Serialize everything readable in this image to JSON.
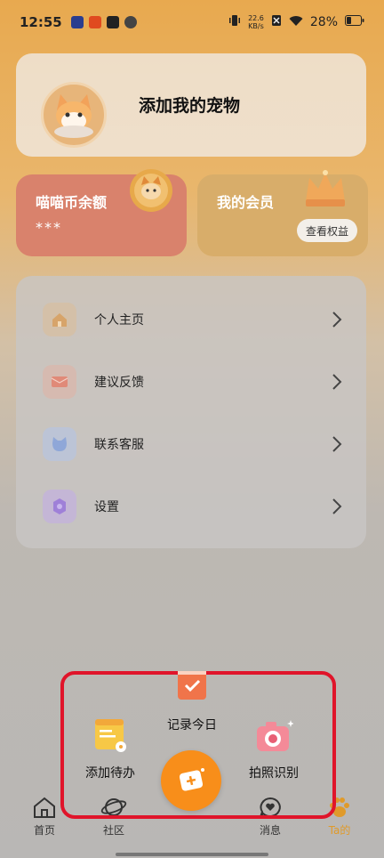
{
  "status_bar": {
    "time": "12:55",
    "net_speed_value": "22.6",
    "net_speed_unit": "KB/s",
    "battery": "28%"
  },
  "pet_card": {
    "title": "添加我的宠物"
  },
  "coin_card": {
    "label": "喵喵币余额",
    "value": "***"
  },
  "member_card": {
    "label": "我的会员",
    "benefit_button": "查看权益"
  },
  "menu": {
    "items": [
      {
        "label": "个人主页",
        "icon": "home-icon",
        "color": "#d7a46a"
      },
      {
        "label": "建议反馈",
        "icon": "mail-icon",
        "color": "#e08a78"
      },
      {
        "label": "联系客服",
        "icon": "cat-icon",
        "color": "#8fa7d8"
      },
      {
        "label": "设置",
        "icon": "gear-icon",
        "color": "#9f80d8"
      }
    ]
  },
  "quick_actions": {
    "record_today": "记录今日",
    "add_todo": "添加待办",
    "photo_recognize": "拍照识别"
  },
  "tab_bar": {
    "items": [
      {
        "label": "首页"
      },
      {
        "label": "社区"
      },
      {
        "label": "消息"
      },
      {
        "label": "Ta的"
      }
    ]
  },
  "colors": {
    "accent": "#f88e1a",
    "highlight_frame": "#e0142a",
    "active_tab": "#e09a2a"
  }
}
